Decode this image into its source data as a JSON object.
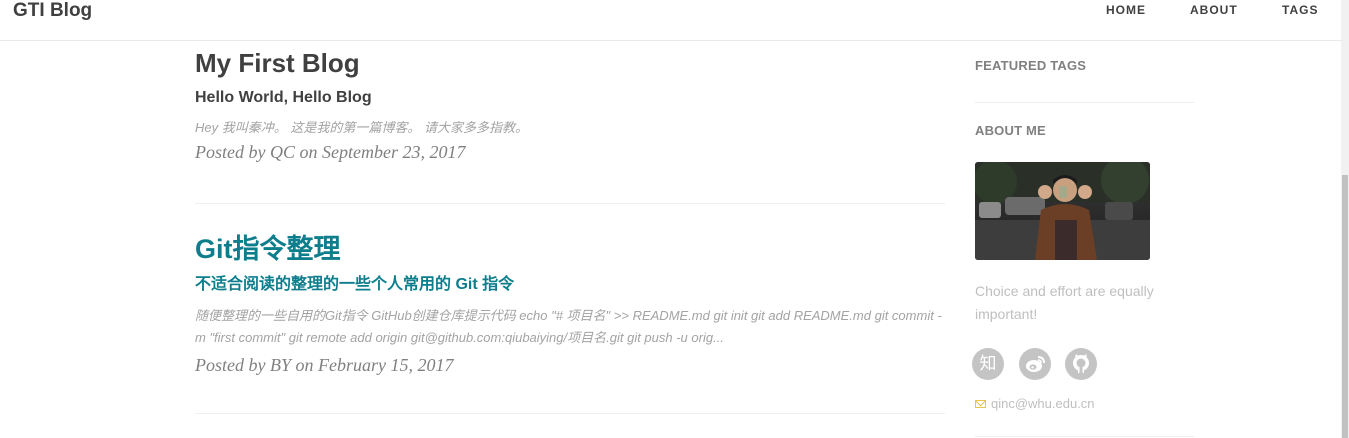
{
  "navbar": {
    "brand": "GTI Blog",
    "links": [
      "HOME",
      "ABOUT",
      "TAGS"
    ]
  },
  "posts": [
    {
      "title": "My First Blog",
      "subtitle": "Hello World, Hello Blog",
      "excerpt": "Hey 我叫秦冲。 这是我的第一篇博客。 请大家多多指教。",
      "meta": "Posted by QC on September 23, 2017"
    },
    {
      "title": "Git指令整理",
      "subtitle": "不适合阅读的整理的一些个人常用的 Git 指令",
      "excerpt": "随便整理的一些自用的Git指令 GitHub创建仓库提示代码 echo \"# 项目名\" >> README.md git init git add README.md git commit -m \"first commit\" git remote add origin git@github.com:qiubaiying/项目名.git git push -u orig...",
      "meta": "Posted by BY on February 15, 2017"
    }
  ],
  "sidebar": {
    "featured_tags_heading": "FEATURED TAGS",
    "about_me_heading": "ABOUT ME",
    "tagline": "Choice and effort are equally important!",
    "social": [
      {
        "name": "zhihu-icon",
        "glyph": "知"
      },
      {
        "name": "weibo-icon",
        "glyph": ""
      },
      {
        "name": "github-icon",
        "glyph": ""
      }
    ],
    "email": "qinc@whu.edu.cn"
  },
  "colors": {
    "text": "#404040",
    "link_teal": "#0e7e8c",
    "muted": "#a3a3a3",
    "meta": "#808080",
    "social_bg": "#c4c4c4"
  }
}
